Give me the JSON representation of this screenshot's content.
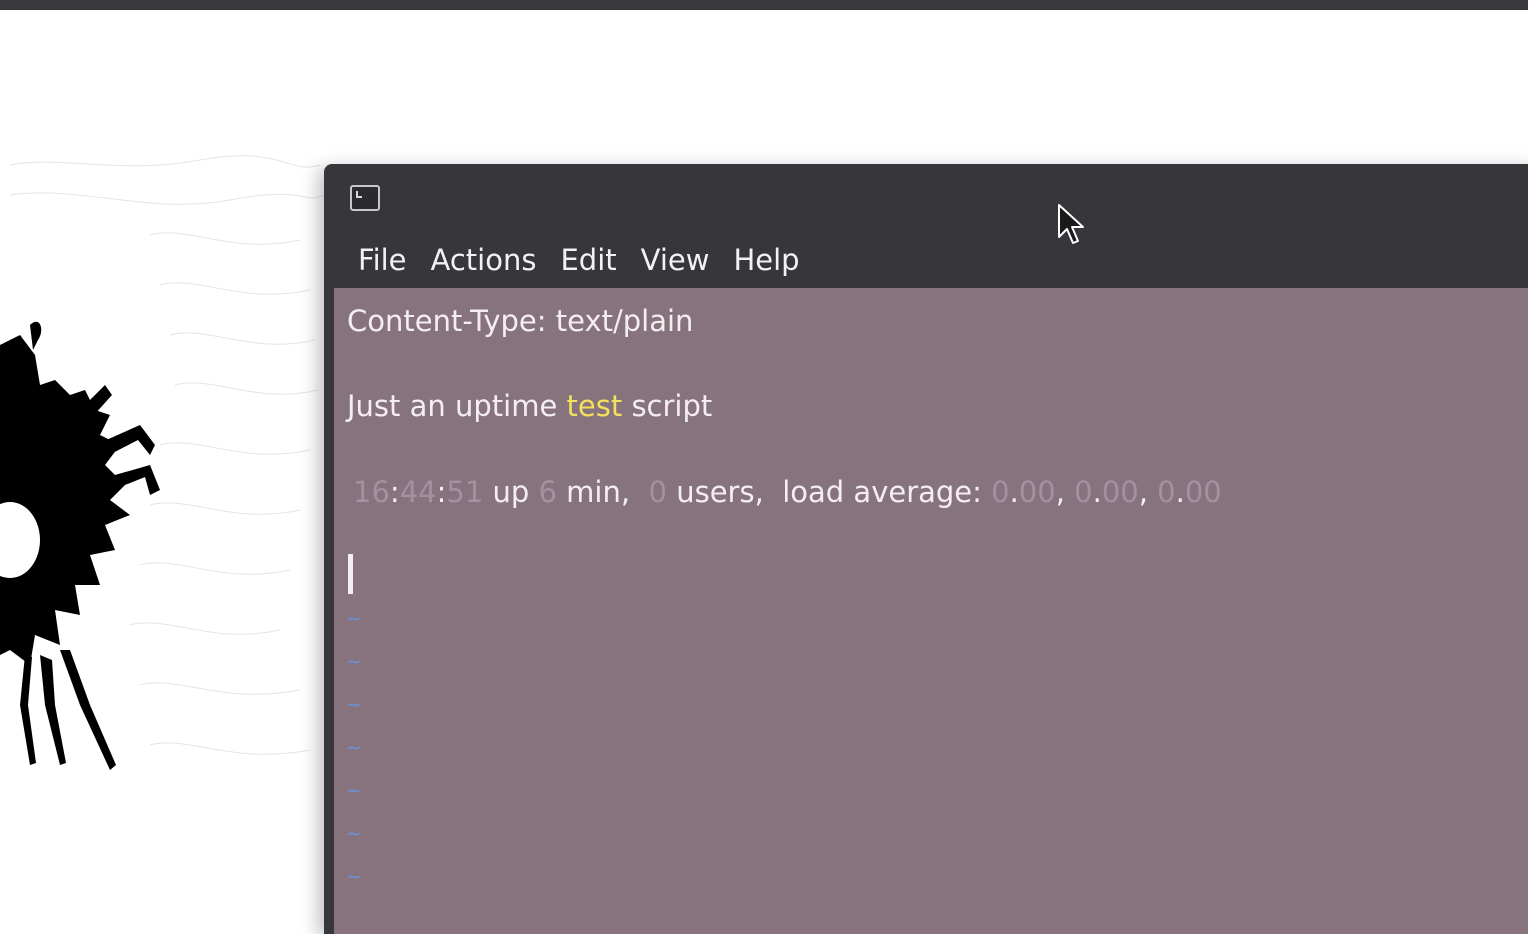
{
  "window": {
    "icon": "terminal-icon"
  },
  "menu": {
    "items": [
      "File",
      "Actions",
      "Edit",
      "View",
      "Help"
    ]
  },
  "terminal": {
    "line1": "Content-Type: text/plain",
    "line2": {
      "before": "Just an uptime ",
      "highlight": "test",
      "after": " script"
    },
    "line3": {
      "hour": "16",
      "sep1": ":",
      "min": "44",
      "sep2": ":",
      "sec": "51",
      "t1": " up ",
      "upmin": "6",
      "t2": " min,  ",
      "users": "0",
      "t3": " users,  load average: ",
      "la1a": "0",
      "la1dot": ".",
      "la1b": "00",
      "c1": ", ",
      "la2a": "0",
      "la2dot": ".",
      "la2b": "00",
      "c2": ", ",
      "la3a": "0",
      "la3dot": ".",
      "la3b": "00"
    },
    "tilde": "~"
  },
  "colors": {
    "terminal_bg": "#87737d",
    "menubar_bg": "#37373b",
    "highlight_yellow": "#f3e05b",
    "number_purple": "#a88ea1",
    "tilde_blue": "#6d8fd8"
  }
}
